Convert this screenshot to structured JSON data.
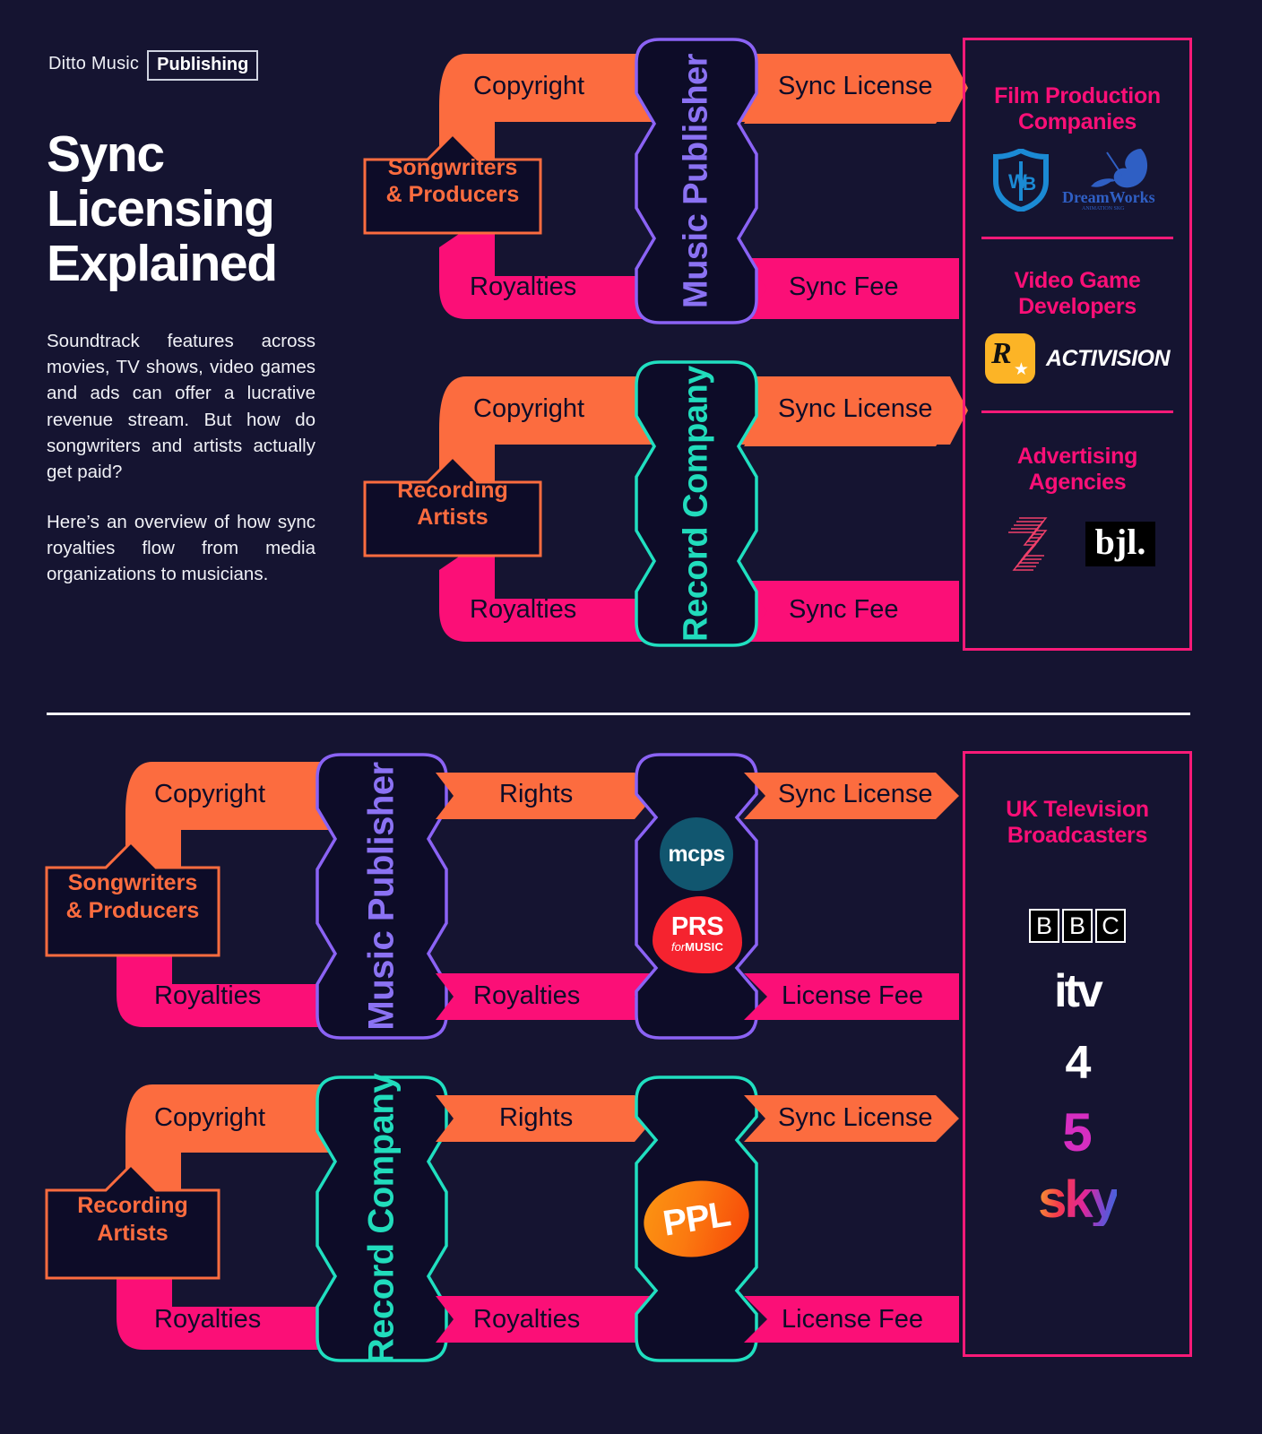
{
  "brand": {
    "prefix": "Ditto Music",
    "boxed": "Publishing"
  },
  "headline": "Sync\nLicensing\nExplained",
  "intro": {
    "p1": "Soundtrack features across movies, TV shows, video games and ads can offer a lucrative revenue stream. But how do songwriters and artists actually   get paid?",
    "p2": "Here’s an overview of how sync royalties flow from media organizations to musicians."
  },
  "colors": {
    "background": "#151431",
    "orange": "#fc6c3f",
    "pink": "#fb0f77",
    "purple": "#8b72f3",
    "teal": "#21dcbc",
    "white": "#ffffff"
  },
  "top_section": {
    "rows": [
      {
        "entity": "Songwriters\n& Producers",
        "hub": "Music Publisher",
        "hub_color": "purple",
        "in_label": "Copyright",
        "out_label": "Royalties",
        "right_top_label": "Sync License",
        "right_bottom_label": "Sync Fee"
      },
      {
        "entity": "Recording\nArtists",
        "hub": "Record Company",
        "hub_color": "teal",
        "in_label": "Copyright",
        "out_label": "Royalties",
        "right_top_label": "Sync License",
        "right_bottom_label": "Sync Fee"
      }
    ],
    "panel": {
      "groups": [
        {
          "title": "Film Production\nCompanies",
          "logos": [
            "wb-logo",
            "dreamworks-logo"
          ]
        },
        {
          "title": "Video Game\nDevelopers",
          "logos": [
            "rockstar-games-logo",
            "activision-logo"
          ]
        },
        {
          "title": "Advertising\nAgencies",
          "logos": [
            "iris-logo",
            "bjl-logo"
          ]
        }
      ],
      "logo_text": {
        "activision": "ACTIVISION",
        "bjl": "bjl.",
        "rockstar_r": "R"
      }
    }
  },
  "bottom_section": {
    "rows": [
      {
        "entity": "Songwriters\n& Producers",
        "hub": "Music Publisher",
        "hub_color": "purple",
        "pro": [
          "mcps-logo",
          "prs-for-music-logo"
        ],
        "pro_color": "purple",
        "in_label": "Copyright",
        "out_label": "Royalties",
        "mid_top_label": "Rights",
        "mid_bottom_label": "Royalties",
        "right_top_label": "Sync License",
        "right_bottom_label": "License Fee"
      },
      {
        "entity": "Recording\nArtists",
        "hub": "Record Company",
        "hub_color": "teal",
        "pro": [
          "ppl-logo"
        ],
        "pro_color": "teal",
        "in_label": "Copyright",
        "out_label": "Royalties",
        "mid_top_label": "Rights",
        "mid_bottom_label": "Royalties",
        "right_top_label": "Sync License",
        "right_bottom_label": "License Fee"
      }
    ],
    "panel": {
      "title": "UK Television\nBroadcasters",
      "logos": [
        "bbc-logo",
        "itv-logo",
        "channel-4-logo",
        "channel-5-logo",
        "sky-logo"
      ],
      "logo_text": {
        "bbc": [
          "B",
          "B",
          "C"
        ],
        "itv": "itv",
        "channel4": "4",
        "channel5": "5",
        "sky": "sky"
      }
    }
  },
  "pro_logo_text": {
    "mcps": "mcps",
    "prs_main": "PRS",
    "prs_for": "for",
    "prs_music": "MUSIC",
    "ppl": "PPL"
  }
}
